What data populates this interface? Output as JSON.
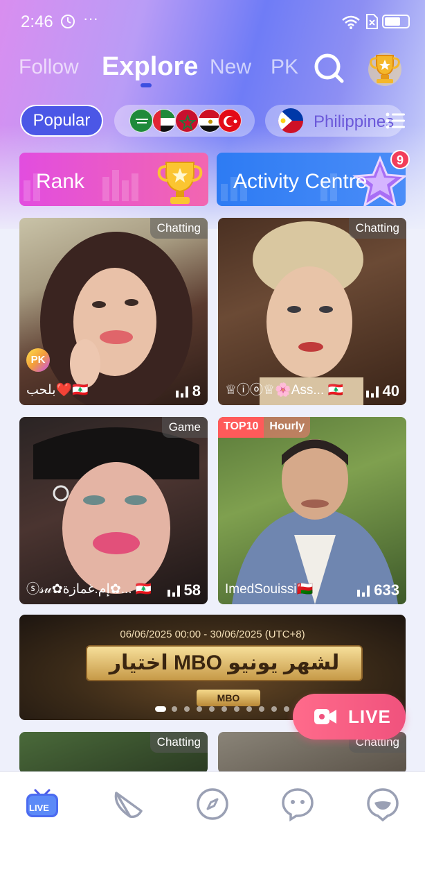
{
  "status_bar": {
    "time": "2:46",
    "dots": "···"
  },
  "tabs": [
    {
      "label": "Follow",
      "active": false
    },
    {
      "label": "Explore",
      "active": true
    },
    {
      "label": "New",
      "active": false
    },
    {
      "label": "PK",
      "active": false
    }
  ],
  "filters": {
    "popular_label": "Popular",
    "region_flags": [
      "saudi-arabia-flag",
      "uae-flag",
      "morocco-flag",
      "egypt-flag",
      "turkey-flag"
    ],
    "country_label": "Philippines"
  },
  "banners": {
    "rank_label": "Rank",
    "activity_label": "Activity Centre",
    "activity_badge": "9"
  },
  "cards": [
    {
      "tag": "Chatting",
      "name": "بلحب❤️🇱🇧",
      "count": "8",
      "pk": "PK"
    },
    {
      "tag": "Chatting",
      "name": "♕ⓘⓞ♕🌸Ass... 🇱🇧",
      "count": "40"
    },
    {
      "tag": "Game",
      "name": "ⓢ𝓈𝓊✿إم.غمازة✿... 🇱🇧",
      "count": "58"
    },
    {
      "tag": "",
      "name": "ImedSouissi🇴🇲",
      "count": "633",
      "top_label": "TOP10",
      "top_period": "Hourly"
    },
    {
      "tag": "Chatting"
    },
    {
      "tag": "Chatting"
    }
  ],
  "event_banner": {
    "date_range": "06/06/2025 00:00 - 30/06/2025 (UTC+8)",
    "title": "اختيار MBO لشهر يونيو",
    "logo": "MBO"
  },
  "live_button": {
    "label": "LIVE"
  },
  "bottom_nav": [
    {
      "icon": "live-tv-icon",
      "label": "LIVE",
      "active": true
    },
    {
      "icon": "party-cone-icon"
    },
    {
      "icon": "compass-icon"
    },
    {
      "icon": "chat-bubble-icon"
    },
    {
      "icon": "profile-icon"
    }
  ],
  "colors": {
    "accent": "#4b57e6",
    "live_pink": "#f0527d",
    "rank_banner": "#e24ddf",
    "activity_banner": "#2d7bf3"
  }
}
